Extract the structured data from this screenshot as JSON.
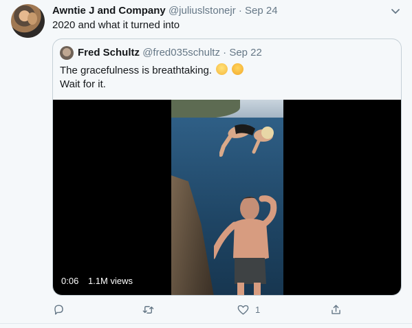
{
  "tweet": {
    "author_name": "Awntie J and Company",
    "handle": "@juliuslstonejr",
    "separator": "·",
    "date": "Sep 24",
    "text": "2020 and what it turned into"
  },
  "quoted_tweet": {
    "author_name": "Fred Schultz",
    "handle": "@fred035schultz",
    "separator": "·",
    "date": "Sep 22",
    "text_line1": "The gracefulness is breathtaking.",
    "text_line2": "Wait for it.",
    "video": {
      "duration": "0:06",
      "views": "1.1M views"
    }
  },
  "actions": {
    "reply_icon": "reply-icon",
    "retweet_icon": "retweet-icon",
    "like_icon": "heart-icon",
    "like_count": "1",
    "share_icon": "share-icon"
  },
  "colors": {
    "secondary_text": "#657786",
    "border": "#c4cfd6",
    "background": "#f5f8fa"
  }
}
